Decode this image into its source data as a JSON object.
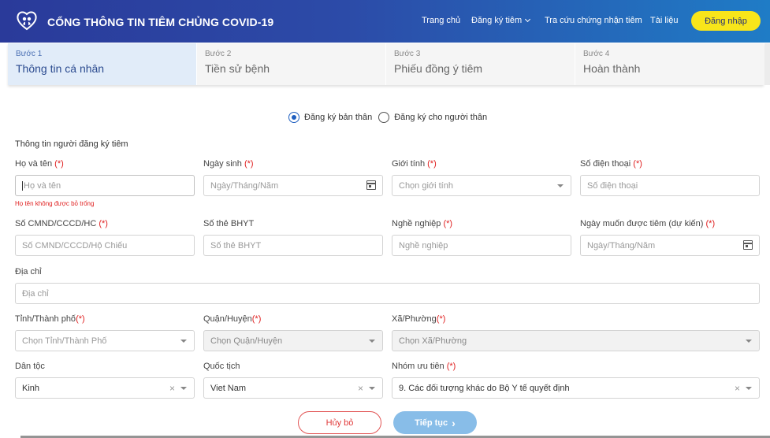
{
  "header": {
    "brand": "CỔNG THÔNG TIN TIÊM CHỦNG COVID-19",
    "nav": [
      "Trang chủ",
      "Đăng ký tiêm",
      "Tra cứu chứng nhận tiêm",
      "Tài liệu"
    ],
    "login": "Đăng nhập"
  },
  "steps": [
    {
      "num": "Bước 1",
      "title": "Thông tin cá nhân",
      "active": true
    },
    {
      "num": "Bước 2",
      "title": "Tiền sử bệnh"
    },
    {
      "num": "Bước 3",
      "title": "Phiếu đồng ý tiêm"
    },
    {
      "num": "Bước 4",
      "title": "Hoàn thành"
    }
  ],
  "register_for": {
    "self": "Đăng ký bản thân",
    "relative": "Đăng ký cho người thân",
    "selected": "self"
  },
  "section_title": "Thông tin người đăng ký tiêm",
  "required_mark": "(*)",
  "fields": {
    "fullname": {
      "label": "Họ và tên",
      "placeholder": "Họ và tên",
      "error": "Họ tên không được bỏ trống"
    },
    "dob": {
      "label": "Ngày sinh",
      "placeholder": "Ngày/Tháng/Năm"
    },
    "gender": {
      "label": "Giới tính",
      "placeholder": "Chọn giới tính"
    },
    "phone": {
      "label": "Số điện thoại",
      "placeholder": "Số điện thoại"
    },
    "idcard": {
      "label": "Số CMND/CCCD/HC",
      "placeholder": "Số CMND/CCCD/Hộ Chiếu"
    },
    "insurance": {
      "label": "Số thẻ BHYT",
      "placeholder": "Số thẻ BHYT"
    },
    "job": {
      "label": "Nghề nghiệp",
      "placeholder": "Nghề nghiệp"
    },
    "wish_date": {
      "label": "Ngày muốn được tiêm (dự kiến)",
      "placeholder": "Ngày/Tháng/Năm"
    },
    "address": {
      "label": "Địa chỉ",
      "placeholder": "Địa chỉ"
    },
    "province": {
      "label": "Tỉnh/Thành phố",
      "placeholder": "Chọn Tỉnh/Thành Phố"
    },
    "district": {
      "label": "Quận/Huyện",
      "placeholder": "Chọn Quận/Huyện"
    },
    "ward": {
      "label": "Xã/Phường",
      "placeholder": "Chọn Xã/Phường"
    },
    "ethnicity": {
      "label": "Dân tộc",
      "value": "Kinh"
    },
    "nationality": {
      "label": "Quốc tịch",
      "value": "Viet Nam"
    },
    "priority": {
      "label": "Nhóm ưu tiên",
      "value": "9. Các đối tượng khác do Bộ Y tế quyết định"
    }
  },
  "buttons": {
    "cancel": "Hủy bỏ",
    "next": "Tiếp tục"
  },
  "clear_glyph": "×",
  "next_glyph": "›"
}
